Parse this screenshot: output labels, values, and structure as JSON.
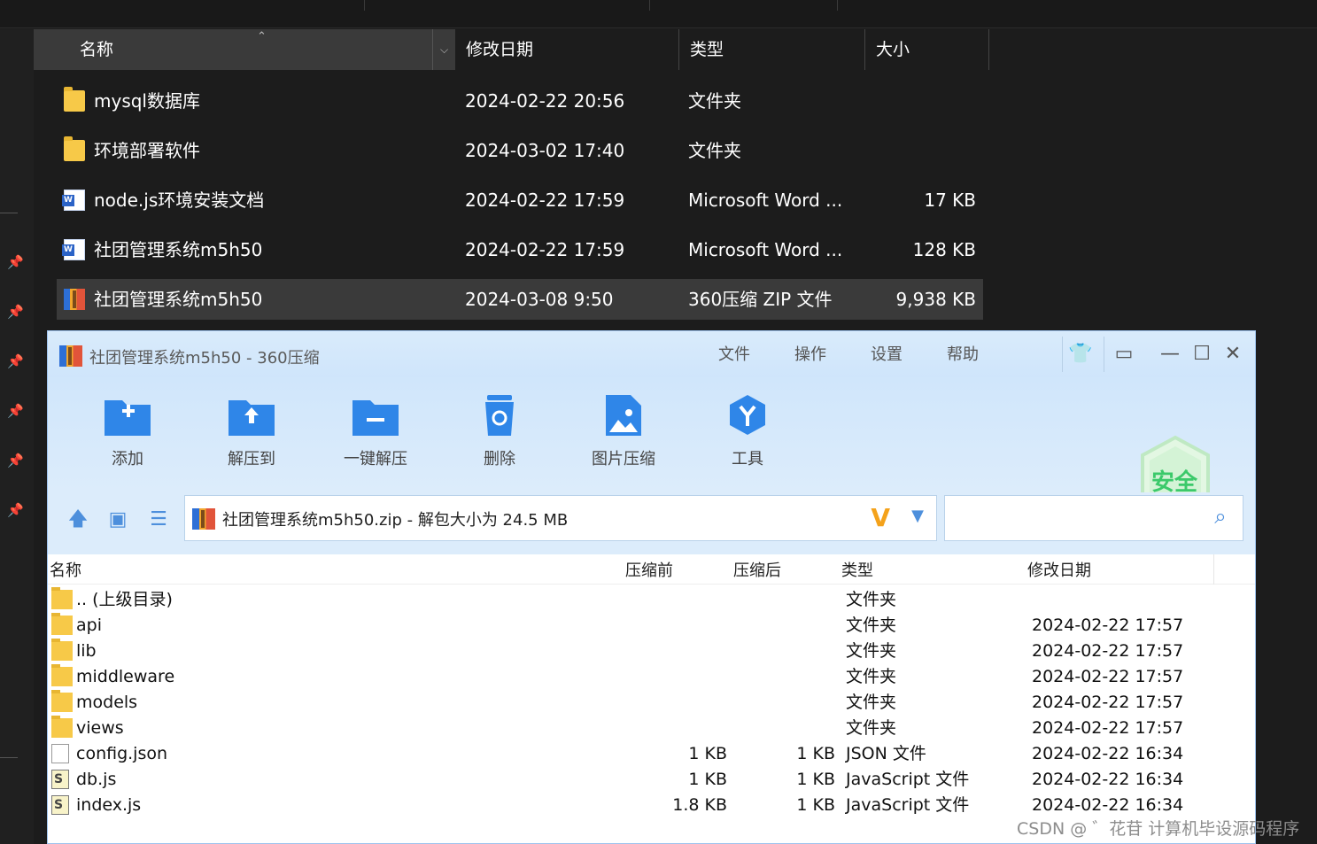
{
  "explorer": {
    "columns": {
      "name": "名称",
      "modified": "修改日期",
      "type": "类型",
      "size": "大小"
    },
    "files": [
      {
        "name": "mysql数据库",
        "modified": "2024-02-22 20:56",
        "type": "文件夹",
        "size": "",
        "icon": "folder-icon"
      },
      {
        "name": "环境部署软件",
        "modified": "2024-03-02 17:40",
        "type": "文件夹",
        "size": "",
        "icon": "folder-icon"
      },
      {
        "name": "node.js环境安装文档",
        "modified": "2024-02-22 17:59",
        "type": "Microsoft Word ...",
        "size": "17 KB",
        "icon": "word-doc-icon"
      },
      {
        "name": "社团管理系统m5h50",
        "modified": "2024-02-22 17:59",
        "type": "Microsoft Word ...",
        "size": "128 KB",
        "icon": "word-doc-icon"
      },
      {
        "name": "社团管理系统m5h50",
        "modified": "2024-03-08 9:50",
        "type": "360压缩 ZIP 文件",
        "size": "9,938 KB",
        "icon": "zip-archive-icon"
      }
    ]
  },
  "zipwin": {
    "title": "社团管理系统m5h50 - 360压缩",
    "menu": [
      "文件",
      "操作",
      "设置",
      "帮助"
    ],
    "tools": [
      {
        "label": "添加",
        "icon": "add-folder-icon"
      },
      {
        "label": "解压到",
        "icon": "extract-to-icon"
      },
      {
        "label": "一键解压",
        "icon": "one-click-extract-icon"
      },
      {
        "label": "删除",
        "icon": "trash-icon"
      },
      {
        "label": "图片压缩",
        "icon": "image-compress-icon"
      },
      {
        "label": "工具",
        "icon": "tools-icon"
      }
    ],
    "security_badge": "安全",
    "address": "社团管理系统m5h50.zip - 解包大小为 24.5 MB",
    "columns": {
      "name": "名称",
      "before": "压缩前",
      "after": "压缩后",
      "type": "类型",
      "modified": "修改日期"
    },
    "entries": [
      {
        "name": ".. (上级目录)",
        "before": "",
        "after": "",
        "type": "文件夹",
        "modified": "",
        "icon": "folder-icon"
      },
      {
        "name": "api",
        "before": "",
        "after": "",
        "type": "文件夹",
        "modified": "2024-02-22 17:57",
        "icon": "folder-icon"
      },
      {
        "name": "lib",
        "before": "",
        "after": "",
        "type": "文件夹",
        "modified": "2024-02-22 17:57",
        "icon": "folder-icon"
      },
      {
        "name": "middleware",
        "before": "",
        "after": "",
        "type": "文件夹",
        "modified": "2024-02-22 17:57",
        "icon": "folder-icon"
      },
      {
        "name": "models",
        "before": "",
        "after": "",
        "type": "文件夹",
        "modified": "2024-02-22 17:57",
        "icon": "folder-icon"
      },
      {
        "name": "views",
        "before": "",
        "after": "",
        "type": "文件夹",
        "modified": "2024-02-22 17:57",
        "icon": "folder-icon"
      },
      {
        "name": "config.json",
        "before": "1 KB",
        "after": "1 KB",
        "type": "JSON 文件",
        "modified": "2024-02-22 16:34",
        "icon": "file-icon"
      },
      {
        "name": "db.js",
        "before": "1 KB",
        "after": "1 KB",
        "type": "JavaScript 文件",
        "modified": "2024-02-22 16:34",
        "icon": "js-file-icon"
      },
      {
        "name": "index.js",
        "before": "1.8 KB",
        "after": "1 KB",
        "type": "JavaScript 文件",
        "modified": "2024-02-22 16:34",
        "icon": "js-file-icon"
      }
    ]
  },
  "watermark": "CSDN @ ゛花苷 计算机毕设源码程序"
}
